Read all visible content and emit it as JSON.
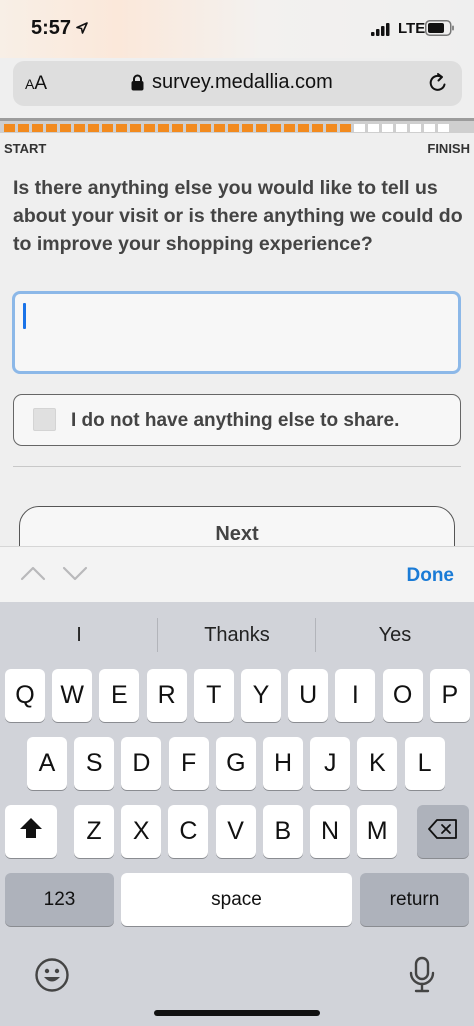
{
  "status_bar": {
    "time": "5:57",
    "network": "LTE",
    "icons": [
      "location-arrow-icon",
      "signal-icon",
      "battery-icon"
    ]
  },
  "browser": {
    "text_size_small": "A",
    "text_size_large": "A",
    "url": "survey.medallia.com",
    "icons": [
      "lock-icon",
      "reload-icon"
    ]
  },
  "progress": {
    "start_label": "START",
    "finish_label": "FINISH",
    "completed_segments": 25,
    "total_segments": 32,
    "fill_color": "#f28a1e"
  },
  "survey": {
    "question": "Is there anything else you would like to tell us about your visit or is there anything we could do to improve your shopping experience?",
    "answer_value": "",
    "opt_out_label": "I do not have anything else to share.",
    "opt_out_checked": false,
    "next_label": "Next"
  },
  "accessory_bar": {
    "done_label": "Done",
    "icons": [
      "chevron-up-icon",
      "chevron-down-icon"
    ]
  },
  "keyboard": {
    "suggestions": [
      "I",
      "Thanks",
      "Yes"
    ],
    "row1": [
      "Q",
      "W",
      "E",
      "R",
      "T",
      "Y",
      "U",
      "I",
      "O",
      "P"
    ],
    "row2": [
      "A",
      "S",
      "D",
      "F",
      "G",
      "H",
      "J",
      "K",
      "L"
    ],
    "row3": [
      "Z",
      "X",
      "C",
      "V",
      "B",
      "N",
      "M"
    ],
    "numbers_label": "123",
    "space_label": "space",
    "return_label": "return",
    "icons": [
      "shift-icon",
      "backspace-icon",
      "emoji-icon",
      "microphone-icon"
    ]
  }
}
